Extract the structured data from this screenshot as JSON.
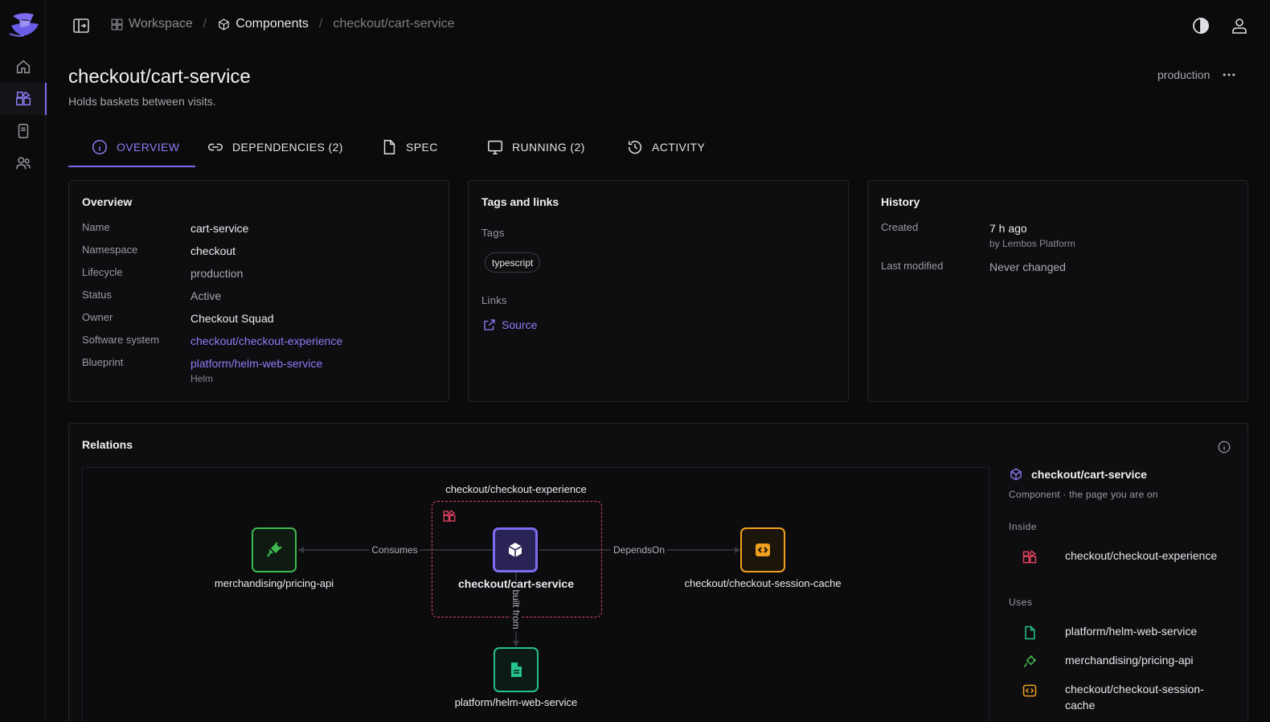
{
  "breadcrumb": [
    {
      "label": "Workspace",
      "icon": "workspace-icon"
    },
    {
      "label": "Components",
      "icon": "cube-icon"
    },
    {
      "label": "checkout/cart-service"
    }
  ],
  "header": {
    "title": "checkout/cart-service",
    "subtitle": "Holds baskets between visits.",
    "lifecycle": "production"
  },
  "tabs": [
    {
      "label": "OVERVIEW",
      "icon": "info-icon",
      "active": true
    },
    {
      "label": "DEPENDENCIES (2)",
      "icon": "link-icon"
    },
    {
      "label": "SPEC",
      "icon": "document-icon"
    },
    {
      "label": "RUNNING (2)",
      "icon": "monitor-icon"
    },
    {
      "label": "ACTIVITY",
      "icon": "history-icon"
    }
  ],
  "overview": {
    "title": "Overview",
    "rows": [
      {
        "label": "Name",
        "value": "cart-service"
      },
      {
        "label": "Namespace",
        "value": "checkout"
      },
      {
        "label": "Lifecycle",
        "value": "production"
      },
      {
        "label": "Status",
        "value": "Active"
      },
      {
        "label": "Owner",
        "value": "Checkout Squad"
      },
      {
        "label": "Software system",
        "value": "checkout/checkout-experience"
      },
      {
        "label": "Blueprint",
        "value": "platform/helm-web-service",
        "hint": "Helm"
      }
    ]
  },
  "tags_links": {
    "title": "Tags and links",
    "tags_label": "Tags",
    "tags": [
      "typescript"
    ],
    "links_label": "Links",
    "links": [
      {
        "label": "Source"
      }
    ]
  },
  "history": {
    "title": "History",
    "created_label": "Created",
    "created_value": "7 h ago",
    "created_by": "by Lembos Platform",
    "modified_label": "Last modified",
    "modified_value": "Never changed"
  },
  "relations": {
    "title": "Relations",
    "graph": {
      "group_label": "checkout/checkout-experience",
      "center": "checkout/cart-service",
      "left": "merchandising/pricing-api",
      "right": "checkout/checkout-session-cache",
      "bottom": "platform/helm-web-service",
      "edge_consumes": "Consumes",
      "edge_depends": "DependsOn",
      "edge_built": "built from"
    },
    "side": {
      "title": "checkout/cart-service",
      "subtitle": "Component · the page you are on",
      "inside_label": "Inside",
      "inside": [
        {
          "label": "checkout/checkout-experience",
          "icon": "system-icon"
        }
      ],
      "uses_label": "Uses",
      "uses": [
        {
          "label": "platform/helm-web-service",
          "icon": "document-icon"
        },
        {
          "label": "merchandising/pricing-api",
          "icon": "plug-icon"
        },
        {
          "label": "checkout/checkout-session-cache",
          "icon": "code-icon"
        }
      ]
    }
  },
  "colors": {
    "accent": "#7c6cf0",
    "system": "#e04360",
    "api": "#3fb950",
    "resource": "#f0a020",
    "template": "#25c28d"
  }
}
